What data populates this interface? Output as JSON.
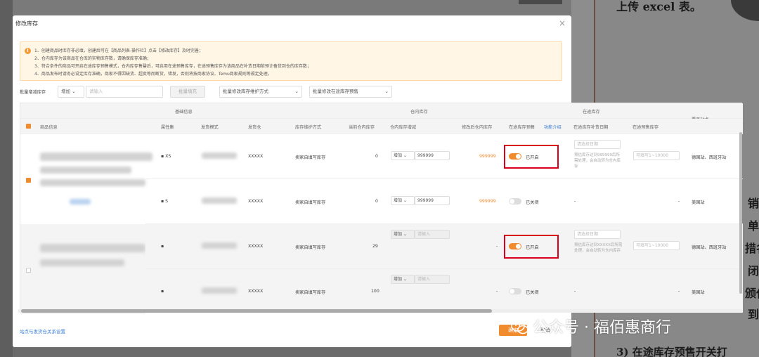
{
  "background": {
    "text_top": "上传 excel 表。",
    "side_chars": [
      "销",
      "单",
      "措名",
      "闭",
      "颁任",
      "到"
    ],
    "bottom_text": "3) 在途库存预售开关打"
  },
  "modal": {
    "title": "修改库存",
    "close": "×",
    "notice_lines": [
      "1、创建商品时库存非必填，创建后可在【商品列表-操作栏】点击【修改库存】及时完善；",
      "2、仓内库存为该商品在仓库的实物库存数，请确保库存准确；",
      "3、符合条件的商品可开启在途库存预售模式，仓内库存售罄后，可启用在途预售库存，在途预售库存为该商品在补货日期前预计备货到仓的库存数；",
      "4、商品发布时请务必设定库存准确，商家不得因缺货、超卖等而断货，错发，否则将按商家协议、Temu商家规则等规定处理。"
    ],
    "filters": {
      "batch_label": "批量增减库存",
      "mode": "增加",
      "input_placeholder": "请输入",
      "batch_button": "批量填充",
      "method_select": "批量修改库存维护方式",
      "presale_select": "批量修改在途库存预售"
    },
    "table": {
      "group_headers": {
        "basic": "基础信息",
        "warehouse": "仓内库存",
        "transit": "在途库存"
      },
      "headers": {
        "product": "商品信息",
        "attr": "属性集",
        "sku": "发货模式",
        "ship": "发货仓",
        "method": "库存维护方式",
        "current": "当前仓内库存",
        "change": "仓内库存增减",
        "after": "修改后仓内库存",
        "presale": "在途库存预售",
        "intro": "功能介绍",
        "restock": "在途库存补货日期",
        "transit_stock": "在途预售库存",
        "site": "覆盖站点"
      },
      "rows": [
        {
          "attr": "XS",
          "ship": "XXXXX",
          "method": "卖家自填写库存",
          "current": "0",
          "mode": "增加",
          "change": "999999",
          "after": "999999",
          "presale": "已开启",
          "on": true,
          "date_placeholder": "请选择日期",
          "date_note": "预估库存达到999999后所需处理，会自动转为仓内库存",
          "transit_placeholder": "可填写1~10000",
          "site": "德国站、西班牙站"
        },
        {
          "attr": "S",
          "ship": "XXXXX",
          "method": "卖家自填写库存",
          "current": "0",
          "mode": "增加",
          "change": "999999",
          "after": "999999",
          "presale": "已关闭",
          "on": false,
          "date": "-",
          "transit": "-",
          "site": "美国站"
        },
        {
          "attr": "",
          "ship": "XXXXX",
          "method": "卖家自填写库存",
          "current": "29",
          "mode": "增加",
          "change_placeholder": "请输入",
          "after": "-",
          "presale": "已开启",
          "on": true,
          "date_placeholder": "请选择日期",
          "date_note": "预估库存达到XXXXX后所需处理，会自动转为仓内库存",
          "transit_placeholder": "可填写1~10000",
          "site": "德国站、西班牙站"
        },
        {
          "attr": "",
          "ship": "XXXXX",
          "method": "卖家自填写库存",
          "current": "100",
          "mode": "增加",
          "change_placeholder": "请输入",
          "after": "-",
          "presale": "已关闭",
          "on": false,
          "date": "-",
          "transit": "-",
          "site": "美国站"
        }
      ]
    },
    "footer_link": "站点与发货仓关系设置",
    "confirm": "确定",
    "cancel": "取消"
  },
  "watermark": "公众号 · 福佰惠商行",
  "colors": {
    "accent": "#f08b2e",
    "highlight": "#d9001b",
    "link": "#3a7bd5"
  }
}
